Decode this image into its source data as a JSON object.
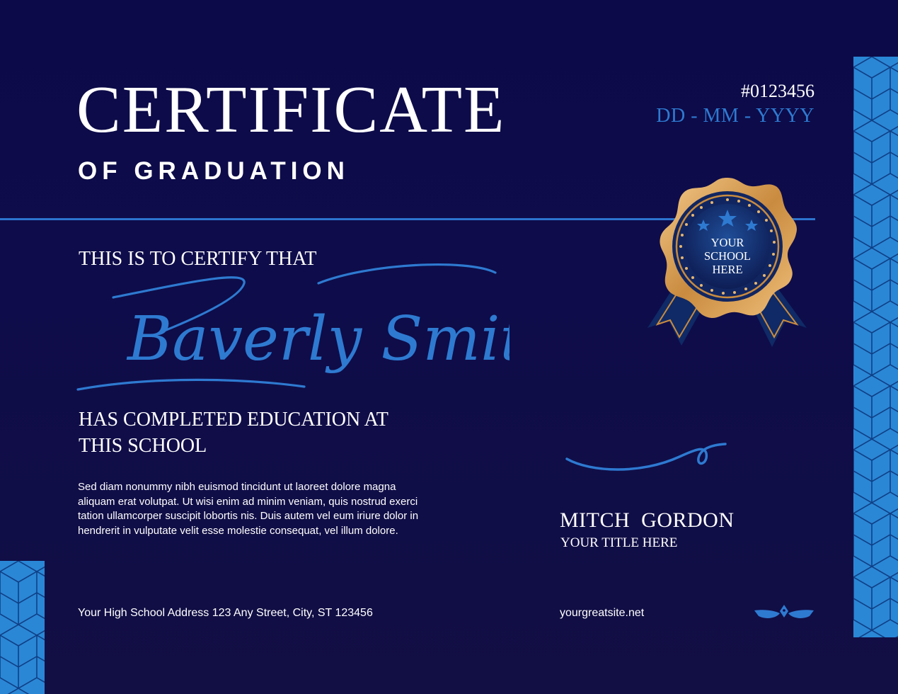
{
  "certificate": {
    "title": "CERTIFICATE",
    "subtitle": "OF GRADUATION",
    "number": "#0123456",
    "date_placeholder": "DD - MM - YYYY"
  },
  "body": {
    "certify_line": "THIS IS TO CERTIFY THAT",
    "recipient_name": "Baverly Smith",
    "completed_line_1": "HAS COMPLETED EDUCATION AT",
    "completed_line_2": "THIS SCHOOL",
    "description": "Sed diam nonummy nibh euismod tincidunt ut laoreet dolore magna aliquam erat volutpat. Ut wisi enim ad minim veniam, quis nostrud exerci tation ullamcorper suscipit lobortis nis. Duis autem vel eum iriure dolor in hendrerit in vulputate velit esse molestie consequat, vel illum dolore."
  },
  "seal": {
    "line_1": "YOUR",
    "line_2": "SCHOOL",
    "line_3": "HERE",
    "icon": "award-seal-icon"
  },
  "signer": {
    "name": "MITCH  GORDON",
    "title": "YOUR TITLE HERE"
  },
  "footer": {
    "address": "Your High School Address 123 Any Street, City, ST 123456",
    "website": "yourgreatsite.net",
    "logo_icon": "pen-nib-wings-logo-icon"
  },
  "colors": {
    "background": "#0d0b48",
    "accent_blue": "#2e7ad1",
    "gold": "#d9a35a",
    "text": "#ffffff"
  }
}
